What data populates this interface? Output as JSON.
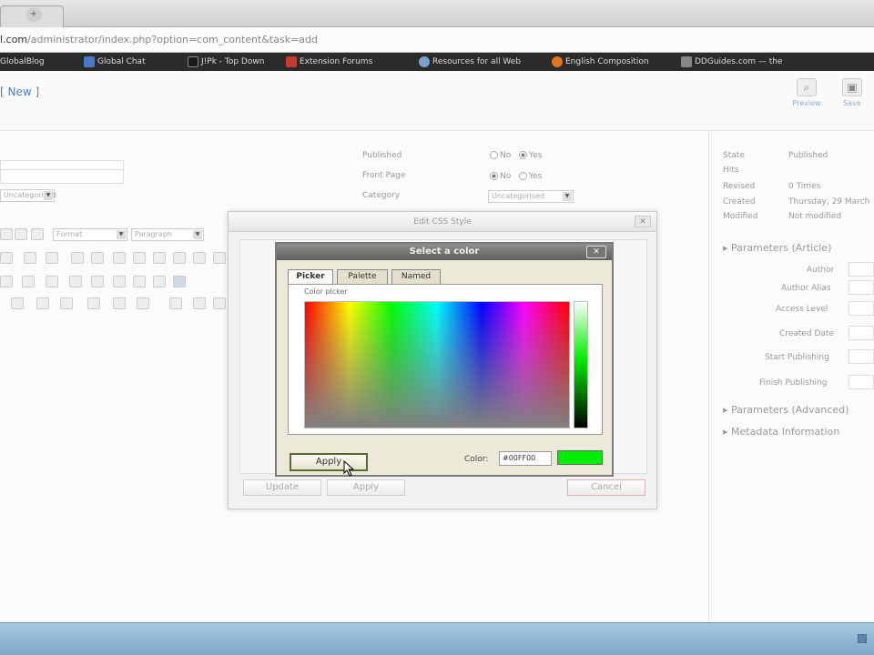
{
  "browser": {
    "new_tab_symbol": "+",
    "url_domain": "l.com",
    "url_path": "/administrator/index.php?option=com_content&task=add",
    "bookmarks": [
      {
        "label": "GlobalBlog",
        "icon": "blog-icon",
        "color": "#8a5a2a"
      },
      {
        "label": "Global Chat",
        "icon": "globe-icon",
        "color": "#4a78c8"
      },
      {
        "label": "J!Pk - Top Down",
        "icon": "person-icon",
        "color": "#1b1b1b"
      },
      {
        "label": "Extension Forums",
        "icon": "forum-icon",
        "color": "#c83a2a"
      },
      {
        "label": "Resources for all Web",
        "icon": "resources-icon",
        "color": "#7aa0d0"
      },
      {
        "label": "English Composition",
        "icon": "firefox-icon",
        "color": "#e07820"
      },
      {
        "label": "DDGuides.com — the",
        "icon": "page-icon",
        "color": "#888888"
      }
    ]
  },
  "toolbar": {
    "page_title": "[ New ]",
    "preview_label": "Preview",
    "save_label": "Save"
  },
  "form": {
    "published_label": "Published",
    "frontpage_label": "Front Page",
    "category_label": "Category",
    "published_no": "No",
    "published_yes": "Yes",
    "frontpage_no": "No",
    "frontpage_yes": "Yes",
    "section_value": "Uncategorised",
    "category_value": "Uncategorised",
    "format_value": "Format",
    "paragraph_value": "Paragraph"
  },
  "sidebar": {
    "state_label": "State",
    "state_value": "Published",
    "hits_label": "Hits",
    "revised_label": "Revised",
    "revised_value": "0 Times",
    "created_label": "Created",
    "created_value": "Thursday, 29 March",
    "modified_label": "Modified",
    "modified_value": "Not modified",
    "params_article": "Parameters (Article)",
    "author_label": "Author",
    "author_alias_label": "Author Alias",
    "access_label": "Access Level",
    "created_date_label": "Created Date",
    "start_pub_label": "Start Publishing",
    "finish_pub_label": "Finish Publishing",
    "params_advanced": "Parameters (Advanced)",
    "metadata": "Metadata Information"
  },
  "css_dialog": {
    "title": "Edit CSS Style",
    "update": "Update",
    "apply": "Apply",
    "cancel": "Cancel",
    "close_symbol": "✕"
  },
  "color_dialog": {
    "title": "Select a color",
    "tabs": [
      "Picker",
      "Palette",
      "Named"
    ],
    "panel_label": "Color picker",
    "apply": "Apply",
    "color_label": "Color:",
    "color_value": "#00FF00",
    "swatch_color": "#00ee00",
    "close_symbol": "✕"
  }
}
